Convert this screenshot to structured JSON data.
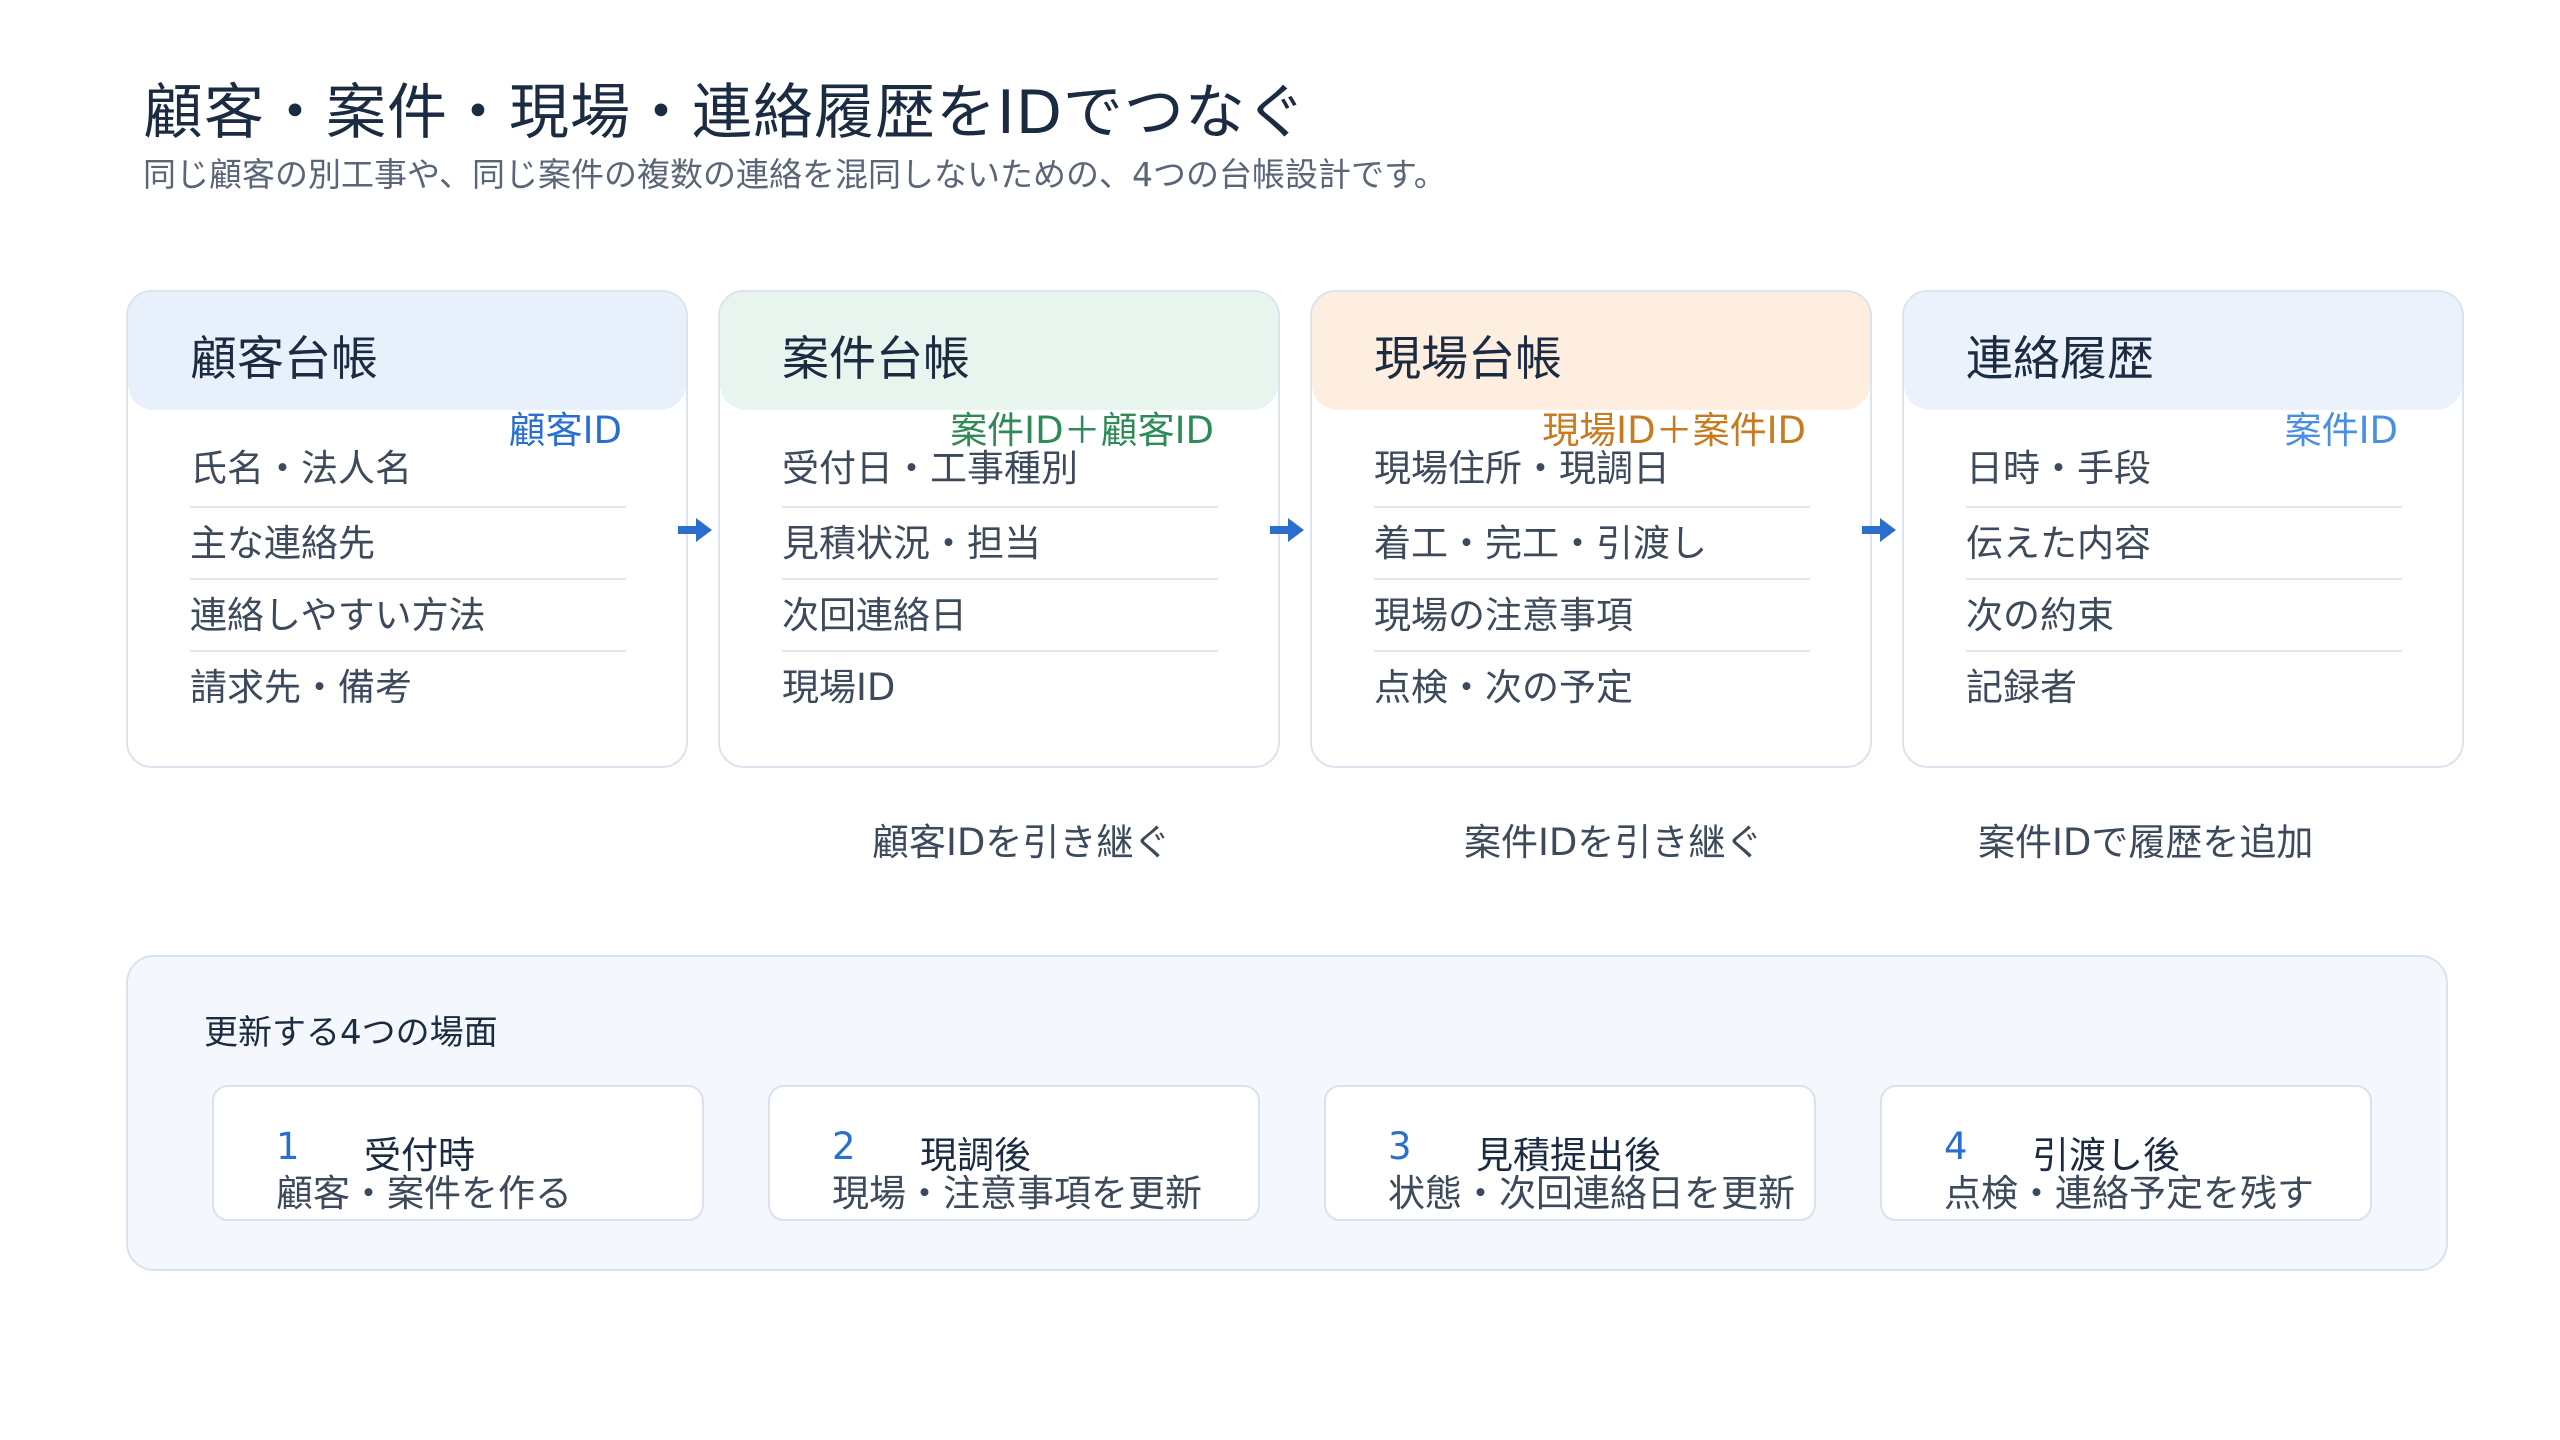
{
  "header": {
    "title": "顧客・案件・現場・連絡履歴をIDでつなぐ",
    "subtitle": "同じ顧客の別工事や、同じ案件の複数の連絡を混同しないための、4つの台帳設計です。"
  },
  "ledgers": [
    {
      "title": "顧客台帳",
      "id_label": "顧客ID",
      "id_color": "#2a6fd0",
      "head_color": "#e8f0fc",
      "rows": [
        "氏名・法人名",
        "主な連絡先",
        "連絡しやすい方法",
        "請求先・備考"
      ]
    },
    {
      "title": "案件台帳",
      "id_label": "案件ID＋顧客ID",
      "id_color": "#2e8b57",
      "head_color": "#e8f5ee",
      "rows": [
        "受付日・工事種別",
        "見積状況・担当",
        "次回連絡日",
        "現場ID"
      ]
    },
    {
      "title": "現場台帳",
      "id_label": "現場ID＋案件ID",
      "id_color": "#c87a1e",
      "head_color": "#fdeee0",
      "rows": [
        "現場住所・現調日",
        "着工・完工・引渡し",
        "現場の注意事項",
        "点検・次の予定"
      ]
    },
    {
      "title": "連絡履歴",
      "id_label": "案件ID",
      "id_color": "#4a90e2",
      "head_color": "#ebf2fc",
      "rows": [
        "日時・手段",
        "伝えた内容",
        "次の約束",
        "記録者"
      ]
    }
  ],
  "arrow_color": "#2a6fd0",
  "captions": [
    "顧客IDを引き継ぐ",
    "案件IDを引き継ぐ",
    "案件IDで履歴を追加"
  ],
  "panel": {
    "title": "更新する4つの場面",
    "steps": [
      {
        "num": "1",
        "name": "受付時",
        "desc": "顧客・案件を作る"
      },
      {
        "num": "2",
        "name": "現調後",
        "desc": "現場・注意事項を更新"
      },
      {
        "num": "3",
        "name": "見積提出後",
        "desc": "状態・次回連絡日を更新"
      },
      {
        "num": "4",
        "name": "引渡し後",
        "desc": "点検・連絡予定を残す"
      }
    ]
  }
}
